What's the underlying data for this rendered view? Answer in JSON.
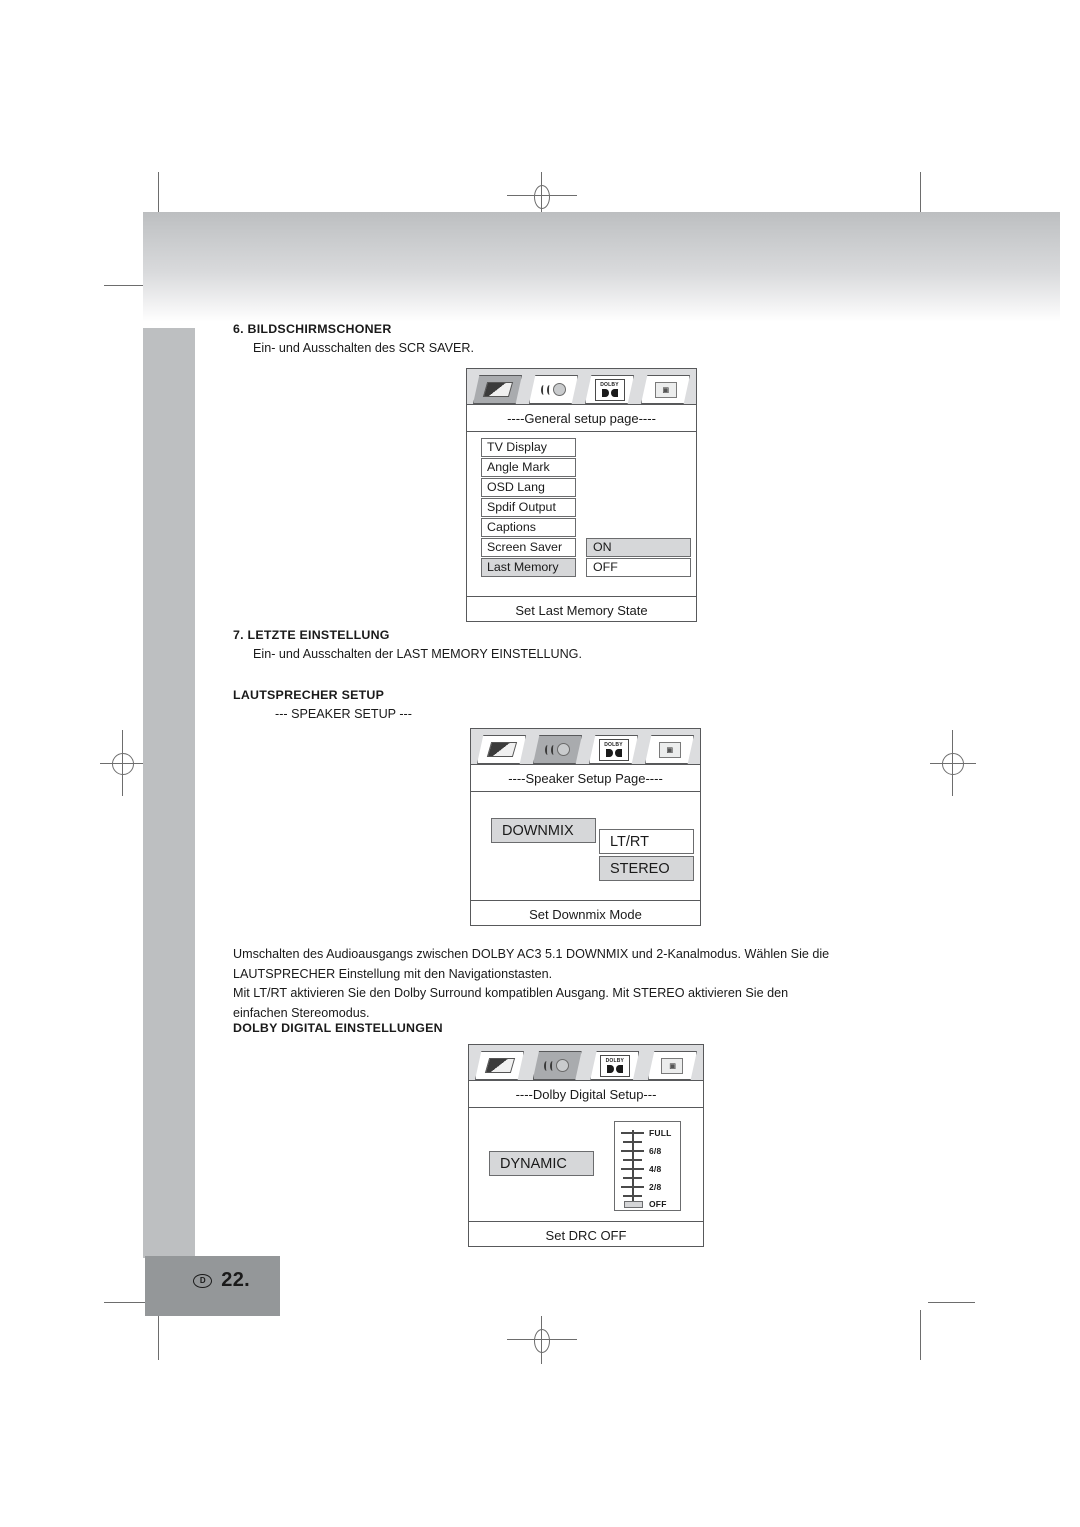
{
  "document": {
    "page_label": "22.",
    "region_badge": "D"
  },
  "sections": [
    {
      "id": "screensaver",
      "title": "6. BILDSCHIRMSCHONER",
      "body": "Ein- und Ausschalten des SCR SAVER."
    },
    {
      "id": "last-memory",
      "title": "7. LETZTE EINSTELLUNG",
      "body": "Ein- und Ausschalten der LAST MEMORY EINSTELLUNG."
    },
    {
      "id": "speaker-setup",
      "title": "LAUTSPRECHER SETUP",
      "body": "--- SPEAKER SETUP ---"
    },
    {
      "id": "dolby-digital",
      "title": "DOLBY DIGITAL EINSTELLUNGEN",
      "body": ""
    }
  ],
  "paragraph": {
    "line1": "Umschalten des Audioausgangs zwischen DOLBY AC3 5.1 DOWNMIX und 2-Kanalmodus. Wählen Sie die",
    "line2": "LAUTSPRECHER Einstellung mit den Navigationstasten.",
    "line3": "Mit LT/RT aktivieren Sie den Dolby Surround kompatiblen Ausgang. Mit STEREO aktivieren Sie den",
    "line4": "einfachen Stereomodus."
  },
  "tabs": {
    "general": "general-setup-icon",
    "audio": "audio-setup-icon",
    "dolby": "dolby-setup-icon",
    "preference": "preference-setup-icon"
  },
  "osd_general": {
    "title": "----General setup page----",
    "footer": "Set Last Memory State",
    "menu": [
      {
        "label": "TV Display",
        "highlighted": false
      },
      {
        "label": "Angle Mark",
        "highlighted": false
      },
      {
        "label": "OSD Lang",
        "highlighted": false
      },
      {
        "label": "Spdif Output",
        "highlighted": false
      },
      {
        "label": "Captions",
        "highlighted": false
      },
      {
        "label": "Screen Saver",
        "highlighted": false
      },
      {
        "label": "Last Memory",
        "highlighted": true
      }
    ],
    "options": [
      {
        "label": "ON",
        "highlighted": true
      },
      {
        "label": "OFF",
        "highlighted": false
      }
    ]
  },
  "osd_speaker": {
    "title": "----Speaker Setup Page----",
    "footer": "Set Downmix Mode",
    "menu": [
      {
        "label": "DOWNMIX",
        "highlighted": true
      }
    ],
    "options": [
      {
        "label": "LT/RT",
        "highlighted": false
      },
      {
        "label": "STEREO",
        "highlighted": true
      }
    ]
  },
  "osd_dolby": {
    "title": "----Dolby Digital Setup---",
    "footer": "Set DRC OFF",
    "menu": [
      {
        "label": "DYNAMIC",
        "highlighted": true
      }
    ],
    "drc": {
      "labels": [
        "FULL",
        "6/8",
        "4/8",
        "2/8",
        "OFF"
      ],
      "current": "OFF"
    }
  },
  "colors": {
    "highlight": "#d6d7d9",
    "outline": "#58595b",
    "left_bar": "#bdbfc1",
    "footer_box": "#949799"
  }
}
